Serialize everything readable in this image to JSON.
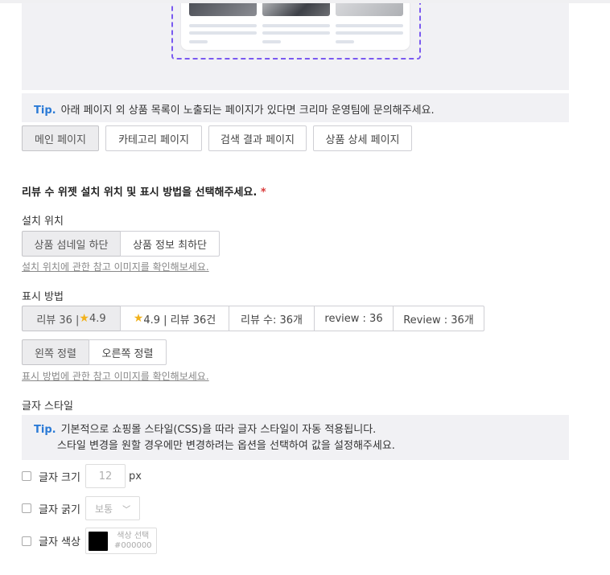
{
  "colors": {
    "accent": "#7a5af0",
    "tip": "#2a7ad6",
    "required": "#d93b3b",
    "swatch": "#000000"
  },
  "tip_pages": {
    "label": "Tip.",
    "text": "아래 페이지 외 상품 목록이 노출되는 페이지가 있다면 크리마 운영팀에 문의해주세요."
  },
  "page_tabs": [
    "메인 페이지",
    "카테고리 페이지",
    "검색 결과 페이지",
    "상품 상세 페이지"
  ],
  "section": {
    "title": "리뷰 수 위젯 설치 위치 및 표시 방법을 선택해주세요.",
    "required_mark": "*"
  },
  "install": {
    "label": "설치 위치",
    "options": [
      "상품 섬네일 하단",
      "상품 정보 최하단"
    ],
    "link": "설치 위치에 관한 참고 이미지를 확인해보세요."
  },
  "display": {
    "label": "표시 방법",
    "formats": {
      "f1_prefix": "리뷰 36 |",
      "f1_suffix": "4.9",
      "f2_suffix": "4.9 | 리뷰 36건",
      "f3": "리뷰 수: 36개",
      "f4": "review : 36",
      "f5": "Review : 36개"
    },
    "align": [
      "왼쪽 정렬",
      "오른쪽 정렬"
    ],
    "link": "표시 방법에 관한 참고 이미지를 확인해보세요."
  },
  "font": {
    "label": "글자 스타일",
    "tip_label": "Tip.",
    "tip_line1": "기본적으로 쇼핑몰 스타일(CSS)을 따라 글자 스타일이 자동 적용됩니다.",
    "tip_line2": "스타일 변경을 원할 경우에만 변경하려는 옵션을 선택하여 값을 설정해주세요.",
    "size": {
      "label": "글자 크기",
      "placeholder": "12",
      "unit": "px"
    },
    "weight": {
      "label": "글자 굵기",
      "value": "보통"
    },
    "color": {
      "label": "글자 색상",
      "caption": "색상 선택",
      "hex": "#000000"
    }
  }
}
